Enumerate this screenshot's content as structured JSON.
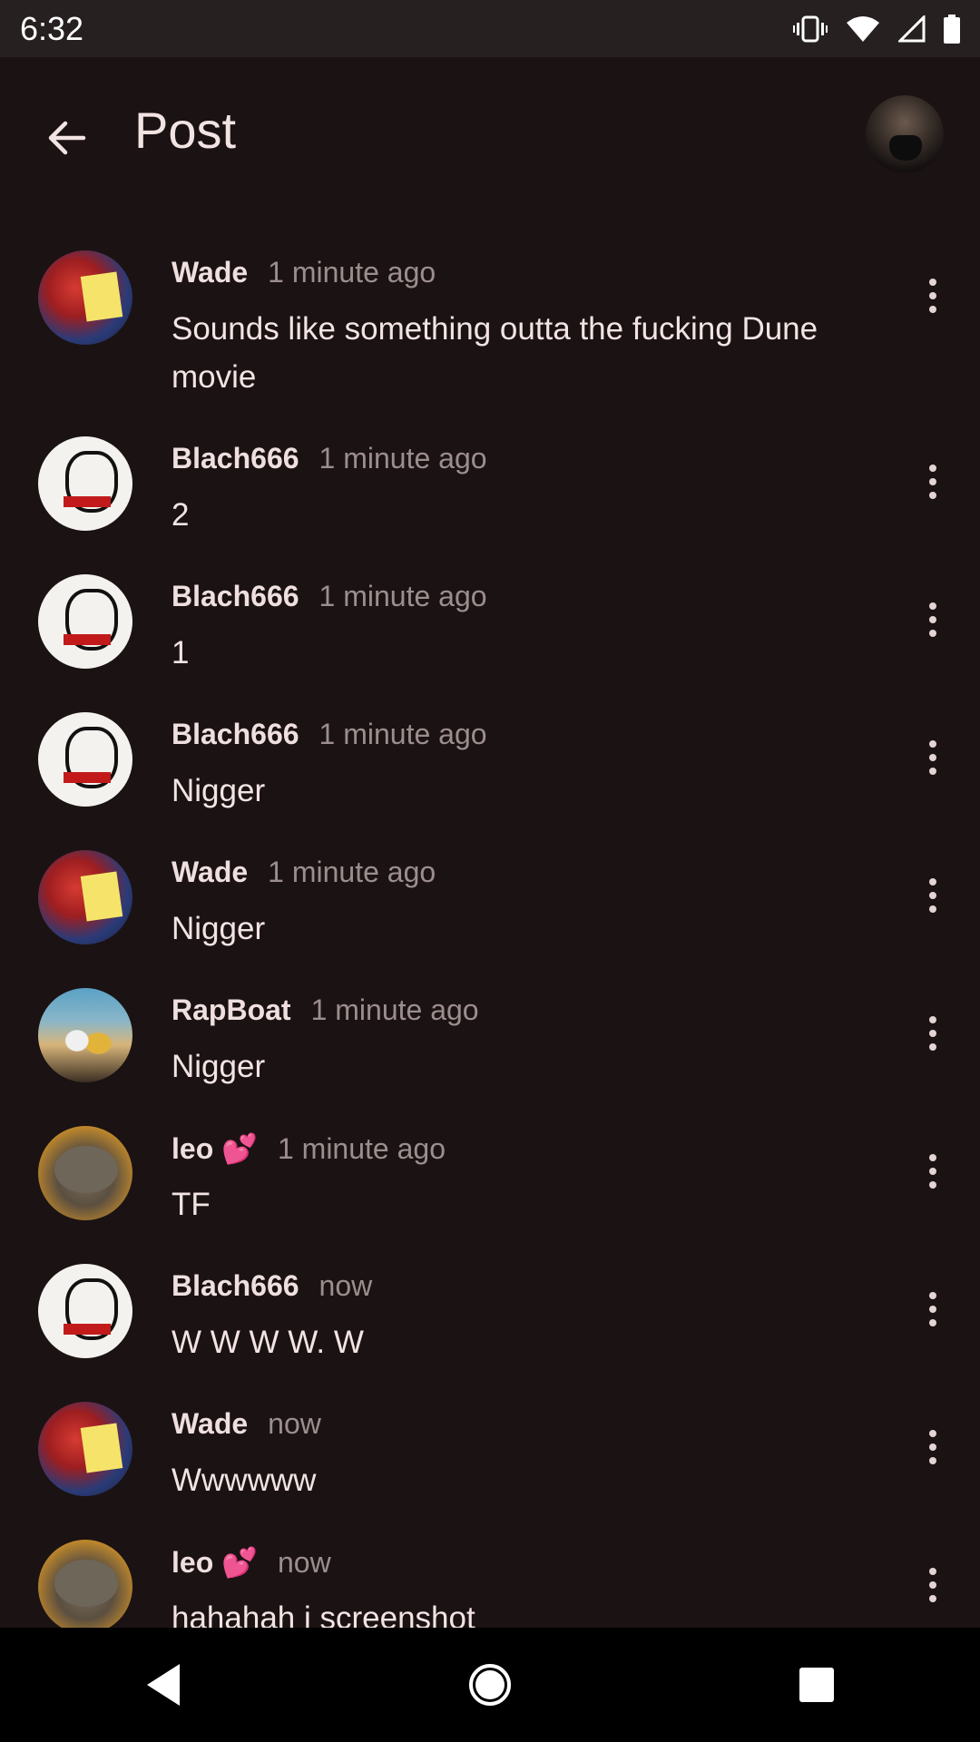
{
  "status_bar": {
    "time": "6:32",
    "icons": [
      "vibrate-icon",
      "wifi-icon",
      "signal-icon",
      "battery-icon"
    ]
  },
  "app_bar": {
    "title": "Post",
    "back_icon": "arrow-back-icon"
  },
  "comments": [
    {
      "author": "Wade",
      "time": "1 minute ago",
      "text": "Sounds like something outta the fucking Dune movie",
      "avatar": "wade"
    },
    {
      "author": "Blach666",
      "time": "1 minute ago",
      "text": "2",
      "avatar": "blach"
    },
    {
      "author": "Blach666",
      "time": "1 minute ago",
      "text": "1",
      "avatar": "blach"
    },
    {
      "author": "Blach666",
      "time": "1 minute ago",
      "text": "Nigger",
      "avatar": "blach"
    },
    {
      "author": "Wade",
      "time": "1 minute ago",
      "text": "Nigger",
      "avatar": "wade"
    },
    {
      "author": "RapBoat",
      "time": "1 minute ago",
      "text": "Nigger",
      "avatar": "rap"
    },
    {
      "author": "leo 💕",
      "time": "1 minute ago",
      "text": "TF",
      "avatar": "leo"
    },
    {
      "author": "Blach666",
      "time": "now",
      "text": "W W W W. W",
      "avatar": "blach"
    },
    {
      "author": "Wade",
      "time": "now",
      "text": "Wwwwww",
      "avatar": "wade"
    },
    {
      "author": "leo 💕",
      "time": "now",
      "text": "hahahah i screenshot",
      "avatar": "leo"
    }
  ],
  "nav_bar": {
    "icons": [
      "back-triangle-icon",
      "home-circle-icon",
      "recents-square-icon"
    ]
  },
  "colors": {
    "background": "#1b1213",
    "status_bar": "#262021",
    "text_primary": "#f3e4e4",
    "text_secondary": "#9c8e8e"
  }
}
